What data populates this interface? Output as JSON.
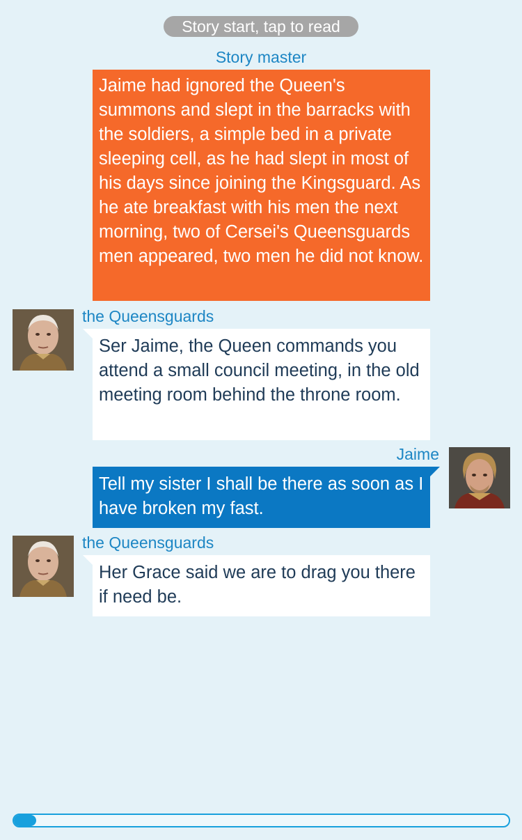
{
  "header": {
    "story_start_label": "Story start, tap to read"
  },
  "messages": [
    {
      "speaker": "Story master",
      "text": "Jaime had ignored the Queen's summons and slept in the barracks with the soldiers, a simple bed in a private sleeping cell, as he had slept in most of his days since joining the Kingsguard. As he ate breakfast with his men the next morning, two of Cersei's Queensguards men appeared, two men he did not know."
    },
    {
      "speaker": "the Queensguards",
      "text": "Ser Jaime, the Queen commands you attend a small council meeting, in the old meeting room behind the throne room."
    },
    {
      "speaker": "Jaime",
      "text": "Tell my sister I shall be there as soon as I have broken my fast."
    },
    {
      "speaker": "the Queensguards",
      "text": "Her Grace said we are to drag you there if need be."
    }
  ],
  "progress": {
    "fraction": 0.045
  },
  "colors": {
    "background": "#e4f2f8",
    "narrator_bubble": "#f5692a",
    "player_bubble": "#0b78c3",
    "other_bubble": "#ffffff",
    "speaker_name": "#1d86c4",
    "progress_accent": "#18a0dd"
  }
}
